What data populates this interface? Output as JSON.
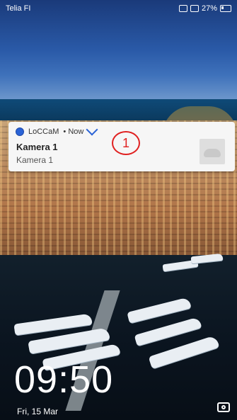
{
  "status_bar": {
    "carrier": "Telia FI",
    "battery_text": "27%"
  },
  "notification": {
    "app_name": "LoCCaM",
    "time_label": "• Now",
    "title": "Kamera 1",
    "body": "Kamera 1"
  },
  "annotation": {
    "number": "1"
  },
  "lockscreen": {
    "time": "09:50",
    "date": "Fri, 15 Mar"
  },
  "icons": {
    "app": "loccam-app-icon",
    "expand": "chevron-down-icon",
    "camera": "camera-icon"
  }
}
